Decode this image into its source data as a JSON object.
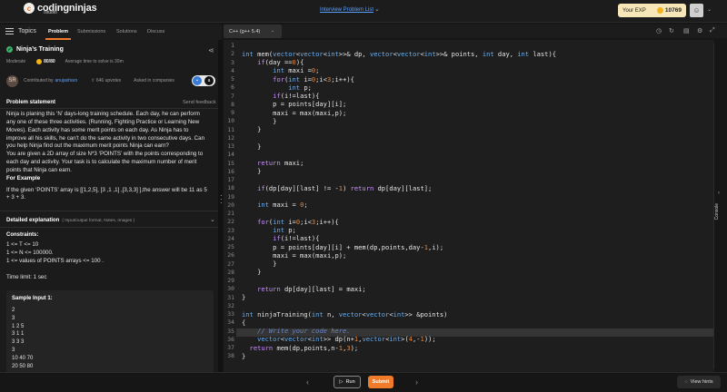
{
  "header": {
    "logo_main": "codingninjas",
    "logo_sub": "/studio",
    "breadcrumb": "Interview Problem List",
    "exp_label": "Your EXP",
    "exp_value": "10769"
  },
  "left_tabs": {
    "topics": "Topics",
    "tabs": [
      "Problem",
      "Submissions",
      "Solutions",
      "Discuss"
    ]
  },
  "problem": {
    "title": "Ninja’s Training",
    "difficulty": "Moderate",
    "score": "80/80",
    "avg_time": "Average time to solve is 30m",
    "avatar_initials": "SR",
    "contributed_by": "Contributed by",
    "contributor": "anujasharo",
    "upvotes": "646 upvotes",
    "asked_in": "Asked in companies",
    "section_statement": "Problem statement",
    "send_feedback": "Send feedback",
    "statement_lines": [
      "Ninja is planing this ‘N’ days-long training schedule. Each day, he can perform",
      "any one of these three activities. (Running, Fighting Practice or Learning New",
      "Moves). Each activity has some merit points on each day. As Ninja has to",
      "improve all his skills, he can’t do the same activity in two consecutive days. Can",
      "you help Ninja find out the maximum merit points Ninja can earn?",
      "You are given a 2D array of size N*3 ‘POINTS’ with the points corresponding to",
      "each day and activity. Your task is to calculate the maximum number of merit",
      "points that Ninja can earn."
    ],
    "for_example": "For Example",
    "example_lines": [
      "If the given ‘POINTS’ array is [[1,2,5], [3 ,1 ,1] ,[3,3,3] ],the answer will be 11 as 5",
      "+ 3 + 3."
    ],
    "detailed_title": "Detailed explanation",
    "detailed_sub": "( Input/output format, Notes, Images )",
    "constraints_title": "Constraints:",
    "constraints": [
      "1 <= T <= 10",
      "1 <= N <= 100000.",
      "1 <= values of POINTS arrays <= 100 ."
    ],
    "time_limit": "Time limit: 1 sec",
    "sample_title": "Sample Input 1:",
    "sample_lines": [
      "2",
      "3",
      "1 2 5",
      "3 1 1",
      "3 3 3",
      "3",
      "10 40 70",
      "20 50 80"
    ]
  },
  "editor": {
    "language": "C++ (g++ 5.4)",
    "code": [
      "",
      "int mem(vector<vector<int>>& dp, vector<vector<int>>& points, int day, int last){",
      "    if(day ==0){",
      "        int maxi =0;",
      "        for(int i=0;i<3;i++){",
      "            int p;",
      "        if(i!=last){",
      "        p = points[day][i];",
      "        maxi = max(maxi,p);",
      "        }",
      "    }",
      "",
      "    }",
      "",
      "    return maxi;",
      "    }",
      "",
      "    if(dp[day][last] != -1) return dp[day][last];",
      "",
      "    int maxi = 0;",
      "",
      "    for(int i=0;i<3;i++){",
      "        int p;",
      "        if(i!=last){",
      "        p = points[day][i] + mem(dp,points,day-1,i);",
      "        maxi = max(maxi,p);",
      "        }",
      "    }",
      "",
      "    return dp[day][last] = maxi;",
      "}",
      "",
      "int ninjaTraining(int n, vector<vector<int>> &points)",
      "{",
      "    // Write your code here.",
      "    vector<vector<int>> dp(n+1,vector<int>(4,-1));",
      "  return mem(dp,points,n-1,3);",
      "}"
    ]
  },
  "console_label": "Console",
  "footer": {
    "run": "Run",
    "submit": "Submit",
    "view_hints": "View hints"
  },
  "colors": {
    "accent": "#f07c2b",
    "link": "#5aa1ff",
    "keyword": "#c990ff",
    "type": "#6ab0f3",
    "number": "#e8863a"
  }
}
